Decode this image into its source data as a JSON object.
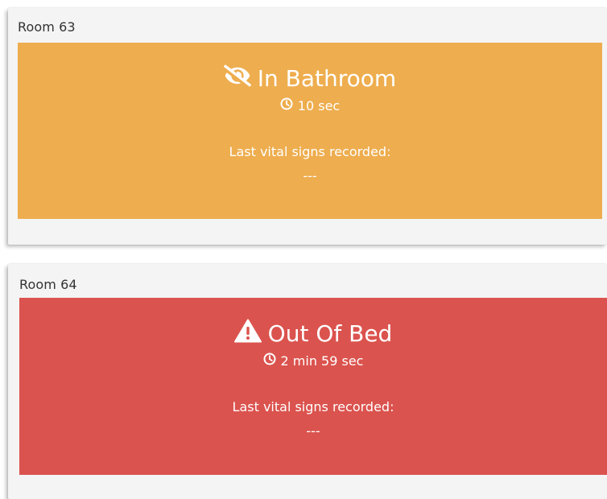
{
  "rooms": [
    {
      "room_label": "Room 63",
      "status_text": "In Bathroom",
      "status_icon": "eye-slash-icon",
      "timer_text": "10 sec",
      "vitals_label": "Last vital signs recorded:",
      "vitals_value": "---",
      "color": "#eead4e"
    },
    {
      "room_label": "Room 64",
      "status_text": "Out Of Bed",
      "status_icon": "warning-triangle-icon",
      "timer_text": "2 min 59 sec",
      "vitals_label": "Last vital signs recorded:",
      "vitals_value": "---",
      "color": "#db534e"
    }
  ],
  "colors": {
    "card_background": "#f4f4f4",
    "text_on_status": "#ffffff"
  }
}
